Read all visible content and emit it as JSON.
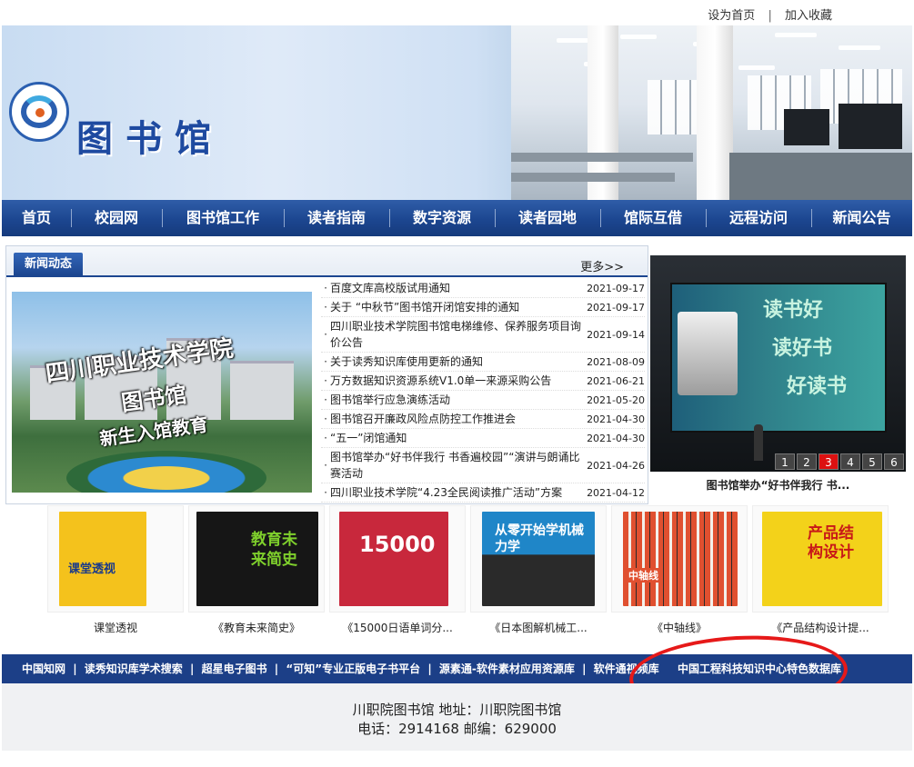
{
  "top_links": {
    "set_home": "设为首页",
    "separator": "|",
    "add_favorite": "加入收藏"
  },
  "brand": {
    "title": "图书馆",
    "emblem_icon": "school-emblem-icon"
  },
  "nav": [
    {
      "label": "首页"
    },
    {
      "label": "校园网"
    },
    {
      "label": "图书馆工作"
    },
    {
      "label": "读者指南"
    },
    {
      "label": "数字资源"
    },
    {
      "label": "读者园地"
    },
    {
      "label": "馆际互借"
    },
    {
      "label": "远程访问"
    },
    {
      "label": "新闻公告"
    }
  ],
  "news": {
    "tab_label": "新闻动态",
    "more_label": "更多>>",
    "photo_caption_line1": "四川职业技术学院",
    "photo_caption_line2": "图书馆",
    "photo_caption_line3": "新生入馆教育",
    "items": [
      {
        "title": "百度文库高校版试用通知",
        "date": "2021-09-17"
      },
      {
        "title": "关于 “中秋节”图书馆开闭馆安排的通知",
        "date": "2021-09-17"
      },
      {
        "title": "四川职业技术学院图书馆电梯维修、保养服务项目询价公告",
        "date": "2021-09-14"
      },
      {
        "title": "关于读秀知识库使用更新的通知",
        "date": "2021-08-09"
      },
      {
        "title": "万方数据知识资源系统V1.0单一来源采购公告",
        "date": "2021-06-21"
      },
      {
        "title": "图书馆举行应急演练活动",
        "date": "2021-05-20"
      },
      {
        "title": "图书馆召开廉政风险点防控工作推进会",
        "date": "2021-04-30"
      },
      {
        "title": "“五一”闭馆通知",
        "date": "2021-04-30"
      },
      {
        "title": "图书馆举办“好书伴我行 书香遍校园”“演讲与朗诵比赛活动",
        "date": "2021-04-26"
      },
      {
        "title": "四川职业技术学院“4.23全民阅读推广活动”方案",
        "date": "2021-04-12"
      }
    ]
  },
  "slideshow": {
    "screen_text_1": "读书好",
    "screen_text_2": "读好书",
    "screen_text_3": "好读书",
    "caption": "图书馆举办“好书伴我行 书...",
    "pages": [
      "1",
      "2",
      "3",
      "4",
      "5",
      "6"
    ],
    "active_page": 3,
    "colors": {
      "active": "#dd1111"
    }
  },
  "books": [
    {
      "label": "课堂透视",
      "cover_text": "课堂透视",
      "cover_color": "#f4c21c"
    },
    {
      "label": "《教育未来简史》",
      "cover_text": "教育未来简史",
      "cover_color": "#161616"
    },
    {
      "label": "《15000日语单词分...",
      "cover_text": "15000",
      "cover_color": "#c8283c"
    },
    {
      "label": "《日本图解机械工...",
      "cover_text": "从零开始学机械力学",
      "cover_color": "#1f86c8"
    },
    {
      "label": "《中轴线》",
      "cover_text": "中轴线",
      "cover_color": "#e05030"
    },
    {
      "label": "《产品结构设计提...",
      "cover_text": "产品结构设计",
      "cover_color": "#f3d21a"
    }
  ],
  "resource_links": [
    "中国知网",
    "读秀知识库学术搜索",
    "超星电子图书",
    "“可知”专业正版电子书平台",
    "源素通-软件素材应用资源库",
    "软件通视频库",
    "中国工程科技知识中心特色数据库"
  ],
  "resource_separator": "|",
  "footer": {
    "line1": "川职院图书馆  地址：川职院图书馆",
    "line2": "电话：2914168  邮编：629000"
  },
  "colors": {
    "nav_blue": "#1c4690",
    "links_blue": "#1c3f87",
    "annotation_red": "#e61919"
  }
}
